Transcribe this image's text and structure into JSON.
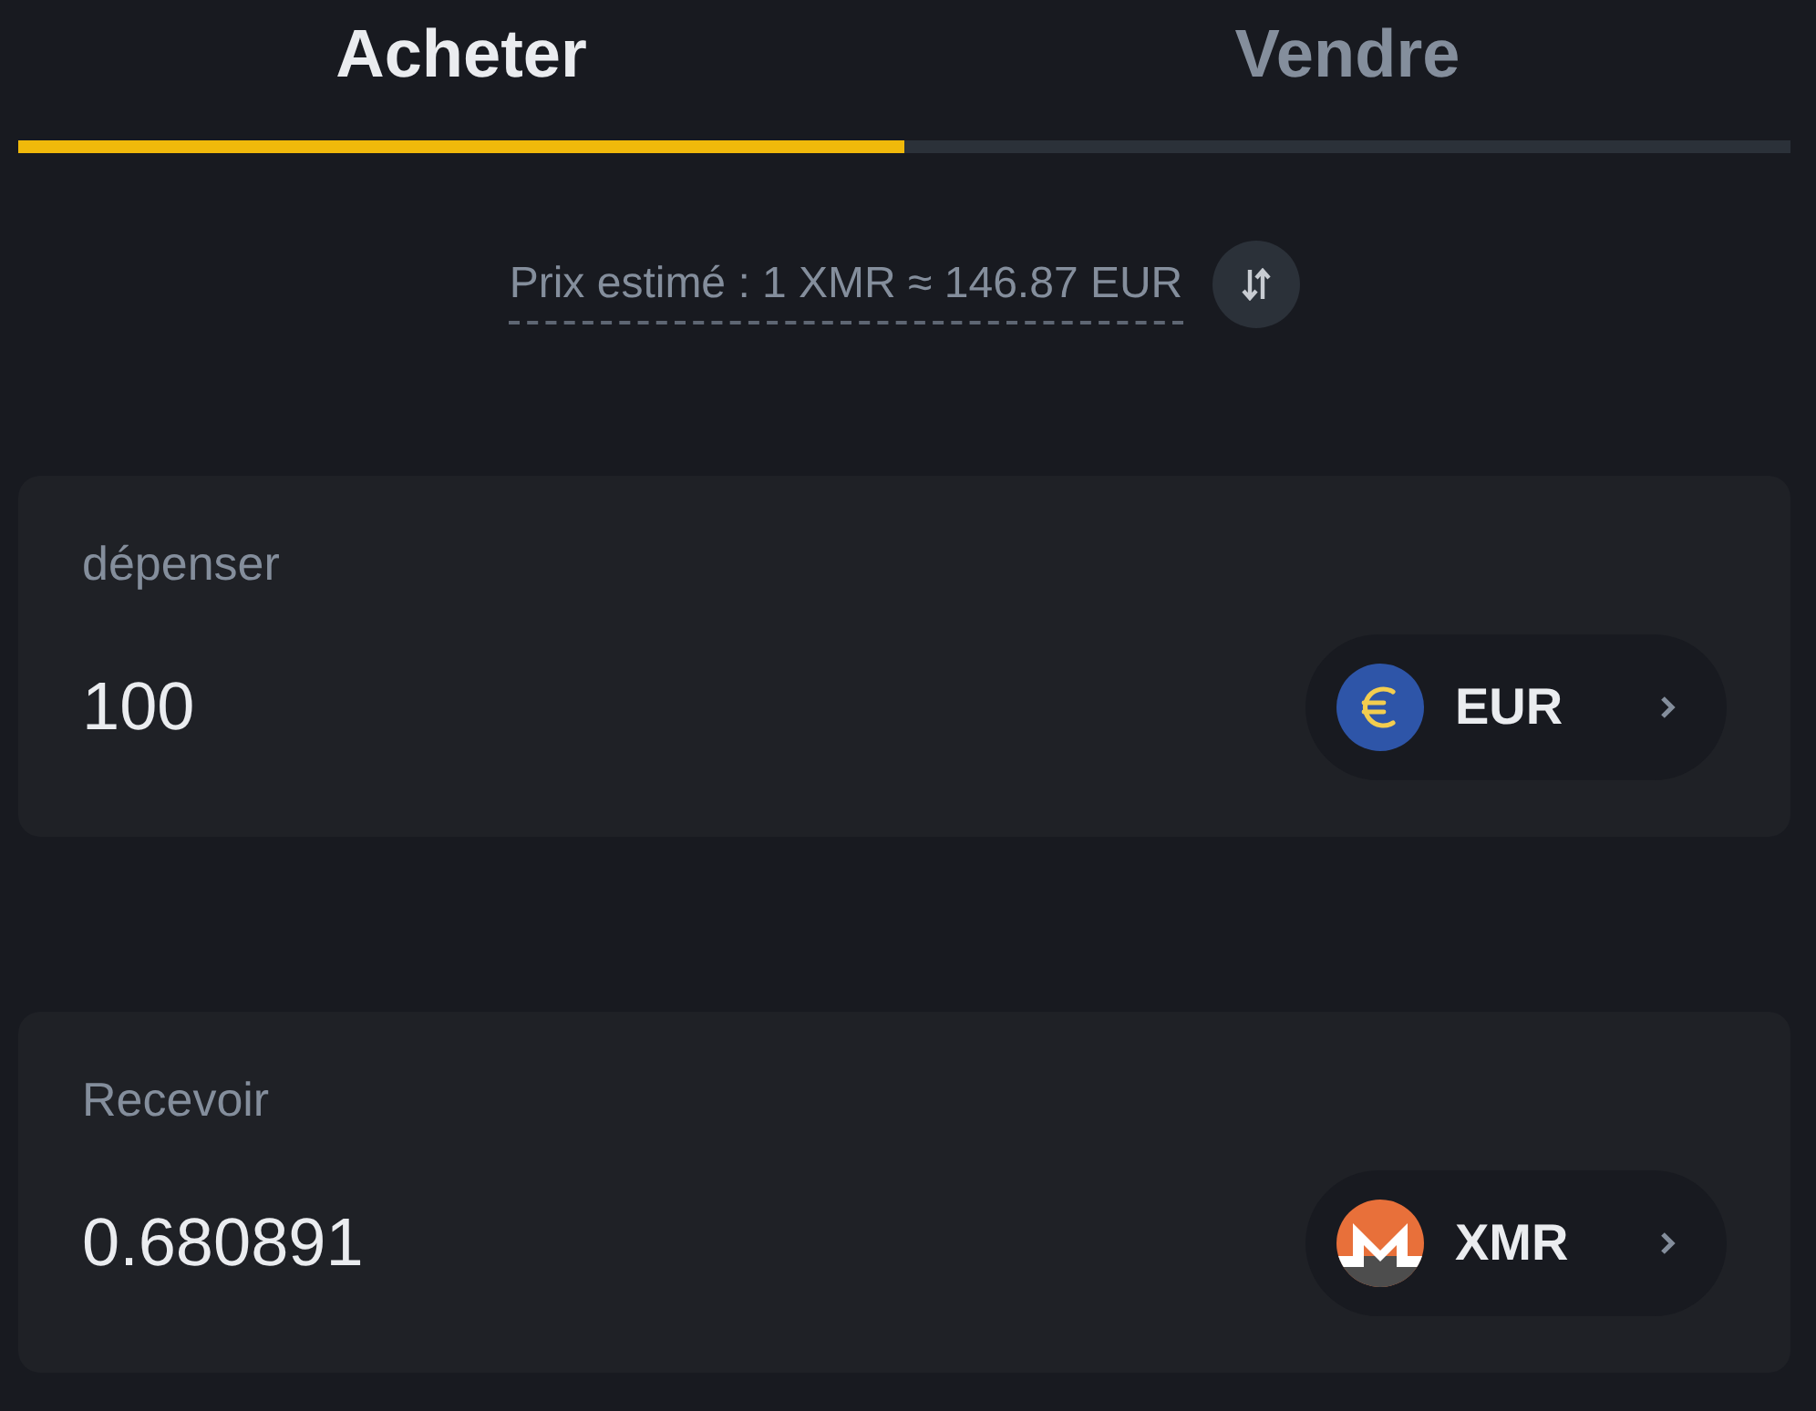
{
  "tabs": [
    {
      "label": "Acheter",
      "selected": true
    },
    {
      "label": "Vendre",
      "selected": false
    }
  ],
  "price": {
    "label": "Prix estimé : 1 XMR ≈ 146.87 EUR"
  },
  "cards": [
    {
      "label": "dépenser",
      "value": "100",
      "currency": {
        "code": "EUR",
        "kind": "euro"
      }
    },
    {
      "label": "Recevoir",
      "value": "0.680891",
      "currency": {
        "code": "XMR",
        "kind": "monero"
      }
    }
  ]
}
